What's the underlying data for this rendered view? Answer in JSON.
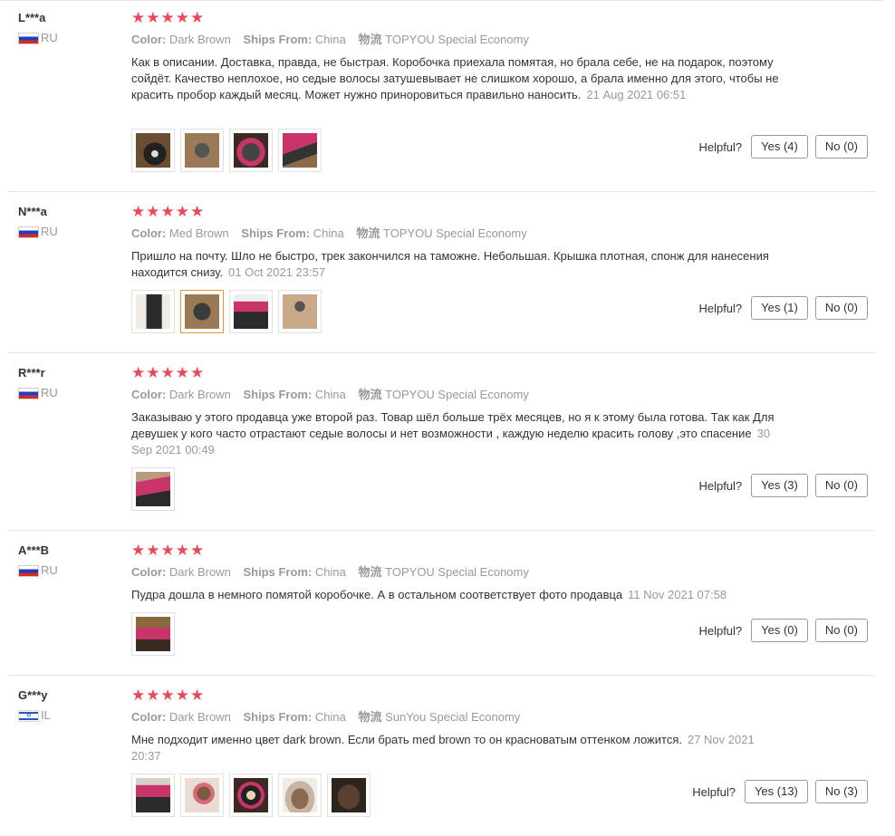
{
  "labels": {
    "color": "Color:",
    "ships_from": "Ships From:",
    "logistics": "物流",
    "helpful": "Helpful?"
  },
  "reviews": [
    {
      "user": "L***a",
      "country": "RU",
      "stars": "★★★★★",
      "color": "Dark Brown",
      "ships_from": "China",
      "logistics": "TOPYOU Special Economy",
      "text": "Как в описании. Доставка, правда, не быстрая. Коробочка приехала помятая, но брала себе, не на подарок, поэтому сойдёт. Качество неплохое, но седые волосы затушевывает не слишком хорошо, а брала именно для этого, чтобы не красить пробор каждый месяц. Может нужно приноровиться правильно наносить.",
      "date": "21 Aug 2021 06:51",
      "yes": "Yes (4)",
      "no": "No (0)"
    },
    {
      "user": "N***a",
      "country": "RU",
      "stars": "★★★★★",
      "color": "Med Brown",
      "ships_from": "China",
      "logistics": "TOPYOU Special Economy",
      "text": "Пришло на почту. Шло не быстро, трек закончился на таможне. Небольшая. Крышка плотная, спонж для нанесения находится снизу.",
      "date": "01 Oct 2021 23:57",
      "yes": "Yes (1)",
      "no": "No (0)"
    },
    {
      "user": "R***r",
      "country": "RU",
      "stars": "★★★★★",
      "color": "Dark Brown",
      "ships_from": "China",
      "logistics": "TOPYOU Special Economy",
      "text": "Заказываю у этого продавца уже второй раз. Товар шёл больше трёх месяцев, но я к этому была готова. Так как Для девушек у кого часто отрастают седые волосы и нет возможности , каждую неделю красить голову ,это спасение",
      "date": "30 Sep 2021 00:49",
      "yes": "Yes (3)",
      "no": "No (0)"
    },
    {
      "user": "A***B",
      "country": "RU",
      "stars": "★★★★★",
      "color": "Dark Brown",
      "ships_from": "China",
      "logistics": "TOPYOU Special Economy",
      "text": "Пудра дошла в немного помятой коробочке. А в остальном соответствует фото продавца",
      "date": "11 Nov 2021 07:58",
      "yes": "Yes (0)",
      "no": "No (0)"
    },
    {
      "user": "G***y",
      "country": "IL",
      "stars": "★★★★★",
      "color": "Dark Brown",
      "ships_from": "China",
      "logistics": "SunYou Special Economy",
      "text": "Мне подходит именно цвет dark brown. Если брать med brown то он красноватым оттенком ложится.",
      "date": "27 Nov 2021 20:37",
      "yes": "Yes (13)",
      "no": "No (3)"
    }
  ]
}
